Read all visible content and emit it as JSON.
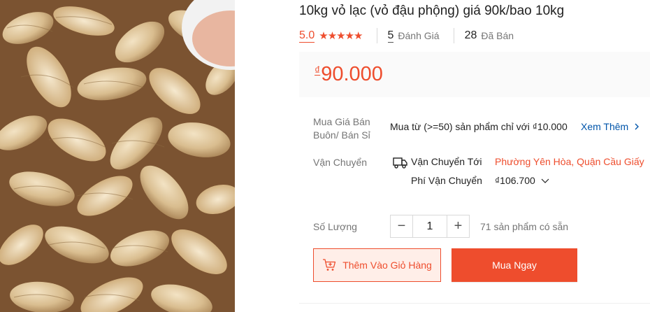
{
  "product": {
    "title": "10kg vỏ lạc (vỏ đậu phộng) giá 90k/bao 10kg",
    "rating": "5.0",
    "stars": "★★★★★",
    "reviews_count": "5",
    "reviews_label": "Đánh Giá",
    "sold_count": "28",
    "sold_label": "Đã Bán",
    "currency": "₫",
    "price": "90.000"
  },
  "wholesale": {
    "label": "Mua Giá Bán Buôn/ Bán Sỉ",
    "text": "Mua từ (>=50) sản phẩm chỉ với ₫10.000",
    "see_more": "Xem Thêm"
  },
  "shipping": {
    "label": "Vận Chuyển",
    "to_label": "Vận Chuyển Tới",
    "address": "Phường Yên Hòa, Quận Cầu Giấy",
    "fee_label": "Phí Vận Chuyển",
    "fee": "₫106.700"
  },
  "quantity": {
    "label": "Số Lượng",
    "minus": "−",
    "value": "1",
    "plus": "+",
    "stock_text": "71 sản phẩm có sẵn"
  },
  "actions": {
    "add_to_cart": "Thêm Vào Giỏ Hàng",
    "buy_now": "Mua Ngay"
  },
  "colors": {
    "accent": "#ee4d2d",
    "link": "#0055aa"
  }
}
